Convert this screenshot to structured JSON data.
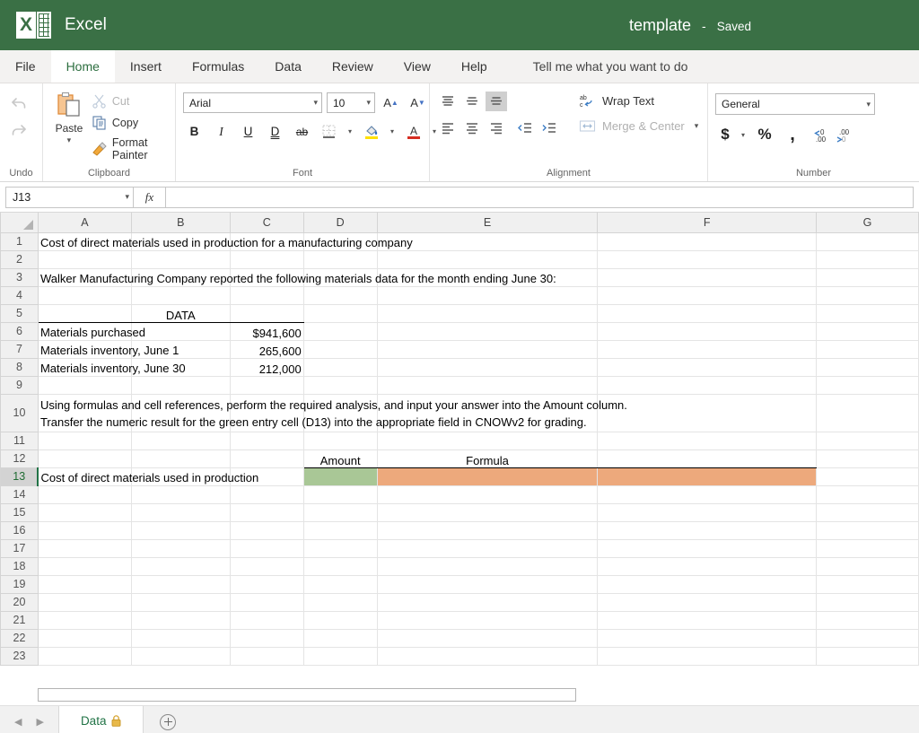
{
  "titlebar": {
    "app_name": "Excel",
    "logo_letter": "X",
    "doc_title": "template",
    "separator": "-",
    "save_status": "Saved"
  },
  "menubar": {
    "tabs": [
      {
        "label": "File",
        "active": false
      },
      {
        "label": "Home",
        "active": true
      },
      {
        "label": "Insert",
        "active": false
      },
      {
        "label": "Formulas",
        "active": false
      },
      {
        "label": "Data",
        "active": false
      },
      {
        "label": "Review",
        "active": false
      },
      {
        "label": "View",
        "active": false
      },
      {
        "label": "Help",
        "active": false
      }
    ],
    "tell_me": "Tell me what you want to do"
  },
  "ribbon": {
    "undo": {
      "label": "Undo",
      "undo_icon": "undo-arrow-icon",
      "redo_icon": "redo-arrow-icon"
    },
    "clipboard": {
      "label": "Clipboard",
      "paste_label": "Paste",
      "cut_label": "Cut",
      "copy_label": "Copy",
      "format_painter_label": "Format Painter"
    },
    "font": {
      "label": "Font",
      "font_name": "Arial",
      "font_size": "10",
      "grow_font": "A",
      "shrink_font": "A",
      "bold": "B",
      "italic": "I",
      "underline": "U",
      "double_underline": "D",
      "strikethrough": "ab",
      "borders_icon": "borders-icon",
      "fill_color_icon": "fill-color-icon",
      "font_color_icon": "font-color-icon"
    },
    "alignment": {
      "label": "Alignment",
      "wrap_text_label": "Wrap Text",
      "merge_center_label": "Merge & Center",
      "align_top_icon": "align-top-icon",
      "align_middle_icon": "align-middle-icon",
      "align_bottom_icon": "align-bottom-icon",
      "align_left_icon": "align-left-icon",
      "align_center_icon": "align-center-icon",
      "align_right_icon": "align-right-icon",
      "decrease_indent_icon": "decrease-indent-icon",
      "increase_indent_icon": "increase-indent-icon"
    },
    "number": {
      "label": "Number",
      "format": "General",
      "currency": "$",
      "percent": "%",
      "comma": ",",
      "increase_decimal_icon": "increase-decimal-icon",
      "decrease_decimal_icon": "decrease-decimal-icon"
    }
  },
  "formula_bar": {
    "name_box": "J13",
    "fx_label": "fx",
    "formula_value": ""
  },
  "grid": {
    "columns": [
      "A",
      "B",
      "C",
      "D",
      "E",
      "F",
      "G"
    ],
    "selected_cell_row": 13,
    "rows": [
      {
        "n": 1,
        "a": "Cost of direct materials used in production for a manufacturing company"
      },
      {
        "n": 2,
        "a": ""
      },
      {
        "n": 3,
        "a": "Walker Manufacturing Company reported the following materials data for the month ending June 30:"
      },
      {
        "n": 4,
        "a": ""
      },
      {
        "n": 5,
        "a": "",
        "b": "DATA",
        "c": ""
      },
      {
        "n": 6,
        "a": "Materials purchased",
        "c": "$941,600"
      },
      {
        "n": 7,
        "a": "Materials inventory, June 1",
        "c": "265,600"
      },
      {
        "n": 8,
        "a": "Materials inventory, June 30",
        "c": "212,000"
      },
      {
        "n": 9,
        "a": ""
      },
      {
        "n": 10,
        "a": "Using formulas and cell references, perform the required analysis, and input your answer into the Amount column.",
        "a2": "Transfer the numeric result for the green entry cell (D13) into the appropriate field in CNOWv2 for grading."
      },
      {
        "n": 11,
        "a": ""
      },
      {
        "n": 12,
        "a": "",
        "d": "Amount",
        "e": "Formula"
      },
      {
        "n": 13,
        "a": "Cost of direct materials used in production",
        "d": "",
        "e": "",
        "f": ""
      },
      {
        "n": 14,
        "a": ""
      },
      {
        "n": 15,
        "a": ""
      },
      {
        "n": 16,
        "a": ""
      },
      {
        "n": 17,
        "a": ""
      },
      {
        "n": 18,
        "a": ""
      },
      {
        "n": 19,
        "a": ""
      },
      {
        "n": 20,
        "a": ""
      },
      {
        "n": 21,
        "a": ""
      },
      {
        "n": 22,
        "a": ""
      },
      {
        "n": 23,
        "a": ""
      }
    ],
    "fill_colors": {
      "amount_entry_green": "#A9C796",
      "formula_orange": "#EDA97C"
    }
  },
  "sheetbar": {
    "prev_icon": "prev-sheet-icon",
    "next_icon": "next-sheet-icon",
    "sheet_name": "Data",
    "lock_icon": "lock-icon",
    "add_sheet_icon": "add-sheet-icon"
  },
  "colors": {
    "header_green": "#3A7045",
    "accent_green": "#217346"
  }
}
